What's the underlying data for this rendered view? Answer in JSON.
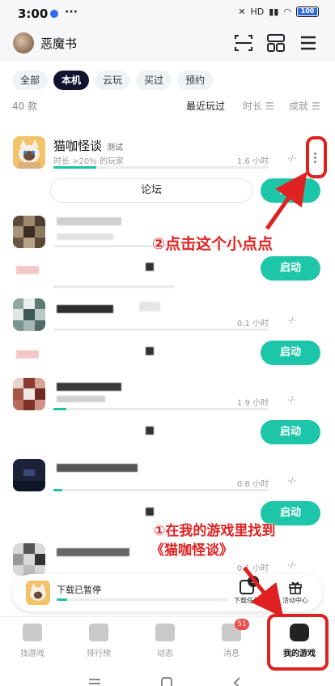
{
  "status_bar": {
    "time": "3:00",
    "more": "···",
    "signal": "HD",
    "battery": "100"
  },
  "header": {
    "username": "恶魔书"
  },
  "tabs": [
    {
      "label": "全部",
      "active": false
    },
    {
      "label": "本机",
      "active": true
    },
    {
      "label": "云玩",
      "active": false
    },
    {
      "label": "买过",
      "active": false
    },
    {
      "label": "预约",
      "active": false
    }
  ],
  "list_meta": {
    "count": "40 款",
    "sort_options": [
      "最近玩过",
      "时长 ☰",
      "成就 ☰"
    ],
    "active_sort": "最近玩过"
  },
  "games": [
    {
      "name": "猫咖怪谈",
      "tag": "测试",
      "subtitle": "时长 >20% 的玩家",
      "hours": "1.6 小时",
      "achievement": "-/-",
      "forum_label": "论坛",
      "launch_label": "启动",
      "progress": 0.2
    },
    {
      "hours": "",
      "achievement": "-/-",
      "launch_label": "启动",
      "progress": 0.0
    },
    {
      "hours": "0.1 小时",
      "achievement": "-/-",
      "launch_label": "启动",
      "progress": 0.0
    },
    {
      "hours": "1.9 小时",
      "achievement": "-/-",
      "launch_label": "启动",
      "progress": 0.06
    },
    {
      "hours": "0.8 小时",
      "achievement": "-/-",
      "launch_label": "启动",
      "progress": 0.04
    },
    {
      "hours": "0.1 小时",
      "achievement": "-/-",
      "launch_label": "",
      "progress": 0.0
    }
  ],
  "download_bar": {
    "label": "下载已暂停",
    "progress": 0.06,
    "task_label": "下载任务",
    "task_count": "3",
    "activity_label": "活动中心"
  },
  "bottom_nav": [
    {
      "label": "找游戏",
      "active": false
    },
    {
      "label": "排行榜",
      "active": false
    },
    {
      "label": "动态",
      "active": false
    },
    {
      "label": "消息",
      "active": false,
      "badge": "51"
    },
    {
      "label": "我的游戏",
      "active": true
    }
  ],
  "annotations": {
    "step2": "②点击这个小点点",
    "step1_line1": "①在我的游戏里找到",
    "step1_line2": "《猫咖怪谈》",
    "color": "#e02121"
  }
}
